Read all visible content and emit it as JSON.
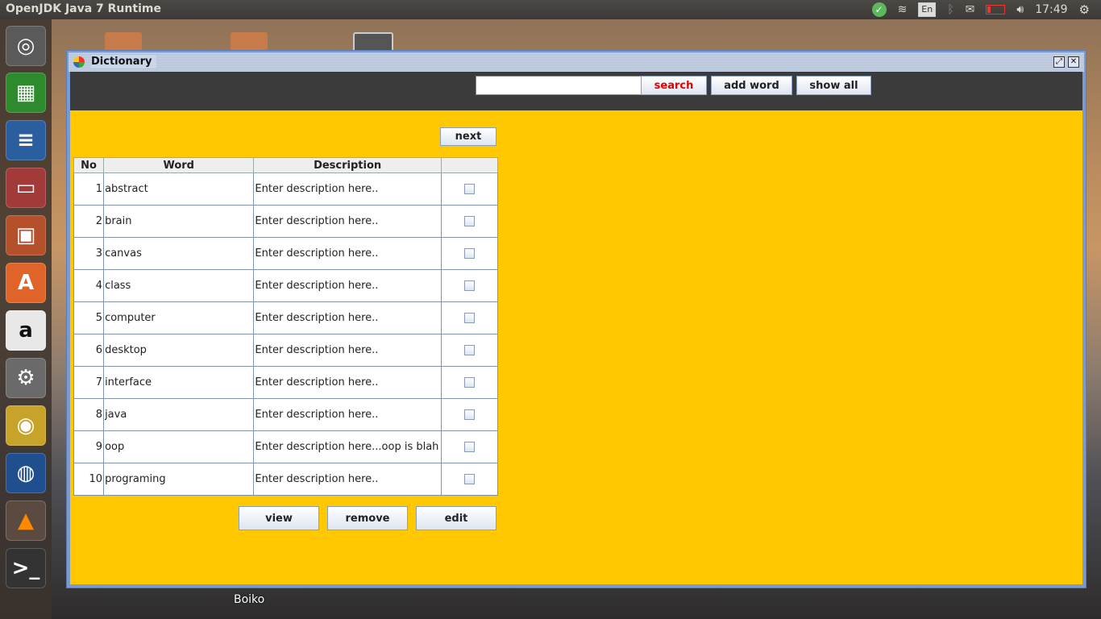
{
  "top_panel": {
    "app_title": "OpenJDK Java 7 Runtime",
    "language": "En",
    "time": "17:49"
  },
  "desktop": {
    "bottom_label": "Boiko"
  },
  "launcher": {
    "items": [
      "ubuntu-icon",
      "spreadsheet-icon",
      "writer-icon",
      "files-icon",
      "impress-icon",
      "software-center-icon",
      "amazon-icon",
      "settings-icon",
      "chrome-icon",
      "google-earth-icon",
      "vlc-icon",
      "terminal-icon"
    ]
  },
  "window": {
    "title": "Dictionary",
    "toolbar": {
      "search_value": "",
      "search_label": "search",
      "add_word_label": "add word",
      "show_all_label": "show all"
    },
    "next_label": "next",
    "table": {
      "headers": [
        "No",
        "Word",
        "Description",
        ""
      ],
      "rows": [
        {
          "no": "1",
          "word": "abstract",
          "description": "Enter description here.."
        },
        {
          "no": "2",
          "word": "brain",
          "description": "Enter description here.."
        },
        {
          "no": "3",
          "word": "canvas",
          "description": "Enter description here.."
        },
        {
          "no": "4",
          "word": "class",
          "description": "Enter description here.."
        },
        {
          "no": "5",
          "word": "computer",
          "description": "Enter description here.."
        },
        {
          "no": "6",
          "word": "desktop",
          "description": "Enter description here.."
        },
        {
          "no": "7",
          "word": "interface",
          "description": "Enter description here.."
        },
        {
          "no": "8",
          "word": "java",
          "description": "Enter description here.."
        },
        {
          "no": "9",
          "word": "oop",
          "description": "Enter description here...oop is blah"
        },
        {
          "no": "10",
          "word": "programing",
          "description": "Enter description here.."
        }
      ]
    },
    "buttons": {
      "view": "view",
      "remove": "remove",
      "edit": "edit"
    }
  },
  "colors": {
    "content_bg": "#ffc800",
    "toolbar_bg": "#3b3b3b",
    "search_text": "#e00000"
  }
}
